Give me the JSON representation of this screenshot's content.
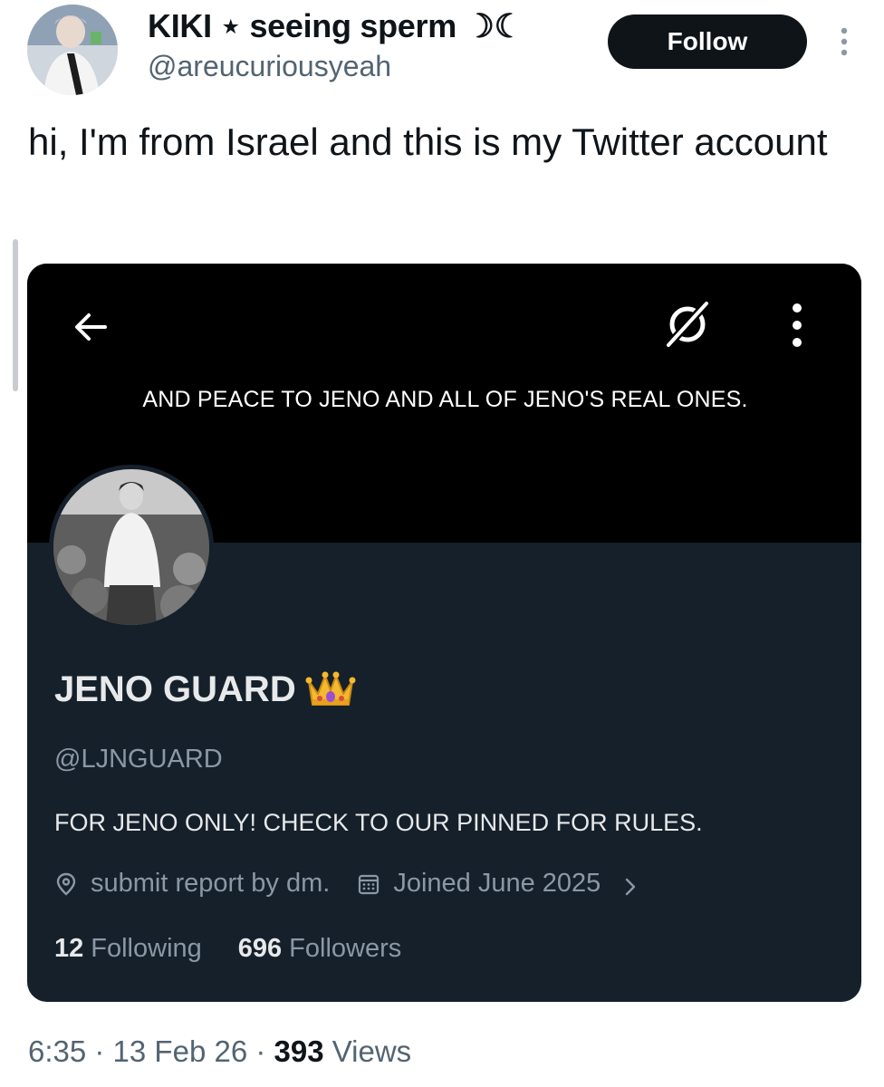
{
  "tweet": {
    "author": {
      "display_name": "KIKI ⋆ seeing sperm ☽☾",
      "handle": "@areucuriousyeah",
      "avatar": "user-avatar-photo"
    },
    "follow_label": "Follow",
    "text": "hi, I'm from Israel and this is my Twitter account",
    "timestamp": "6:35 · 13 Feb 26 · ",
    "views_count": "393",
    "views_label": " Views"
  },
  "embedded_profile": {
    "banner_text": "AND PEACE TO JENO AND ALL OF JENO'S REAL ONES.",
    "name": "JENO GUARD",
    "name_emoji": "crown-emoji",
    "handle": "@LJNGUARD",
    "bio": "FOR JENO ONLY! CHECK TO OUR PINNED FOR RULES.",
    "location": "submit report by dm.",
    "joined": "Joined June 2025",
    "following_count": "12",
    "following_label": "Following",
    "followers_count": "696",
    "followers_label": "Followers"
  },
  "colors": {
    "follow_button_bg": "#0f1419",
    "card_bg": "#15202b",
    "banner_bg": "#000000",
    "secondary_text": "#536471",
    "card_secondary_text": "#8b98a5"
  }
}
